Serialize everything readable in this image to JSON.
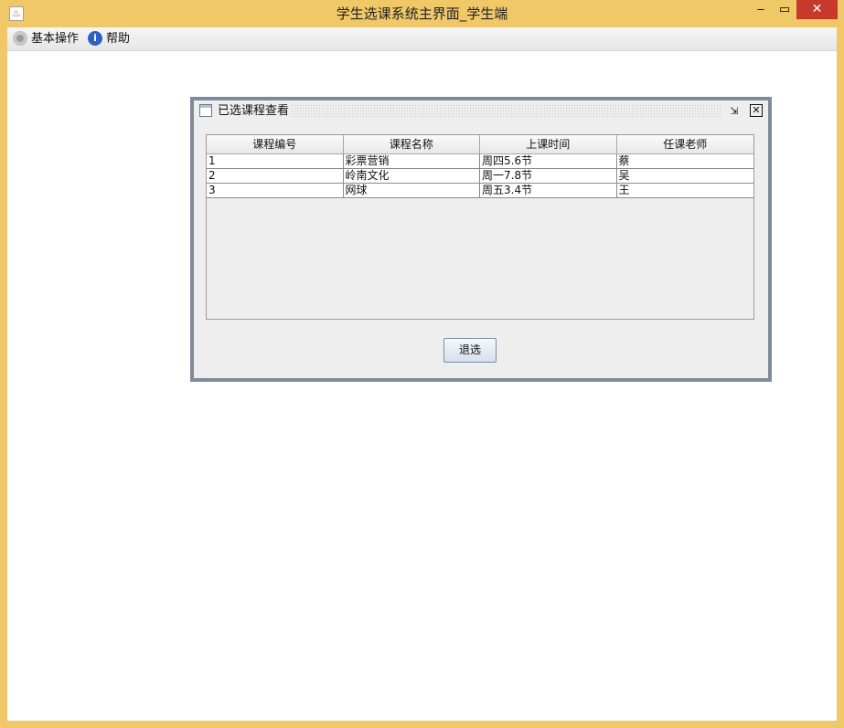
{
  "window": {
    "title": "学生选课系统主界面_学生端"
  },
  "titlebar_buttons": {
    "minimize": "‒",
    "maximize": "▭",
    "close": "✕"
  },
  "menubar": {
    "items": [
      {
        "label": "基本操作",
        "icon": "gear-icon"
      },
      {
        "label": "帮助",
        "icon": "info-icon"
      }
    ]
  },
  "internal_frame": {
    "title": "已选课程查看",
    "columns": [
      "课程编号",
      "课程名称",
      "上课时间",
      "任课老师"
    ],
    "rows": [
      [
        "1",
        "彩票营销",
        "周四5.6节",
        "蔡"
      ],
      [
        "2",
        "岭南文化",
        "周一7.8节",
        "吴"
      ],
      [
        "3",
        "网球",
        "周五3.4节",
        "王"
      ]
    ],
    "withdraw_button": "退选"
  },
  "colors": {
    "window_frame": "#F0C868",
    "close_button": "#C7392B",
    "frame_border": "#7E8C9A",
    "panel_bg": "#EEEEEE"
  }
}
